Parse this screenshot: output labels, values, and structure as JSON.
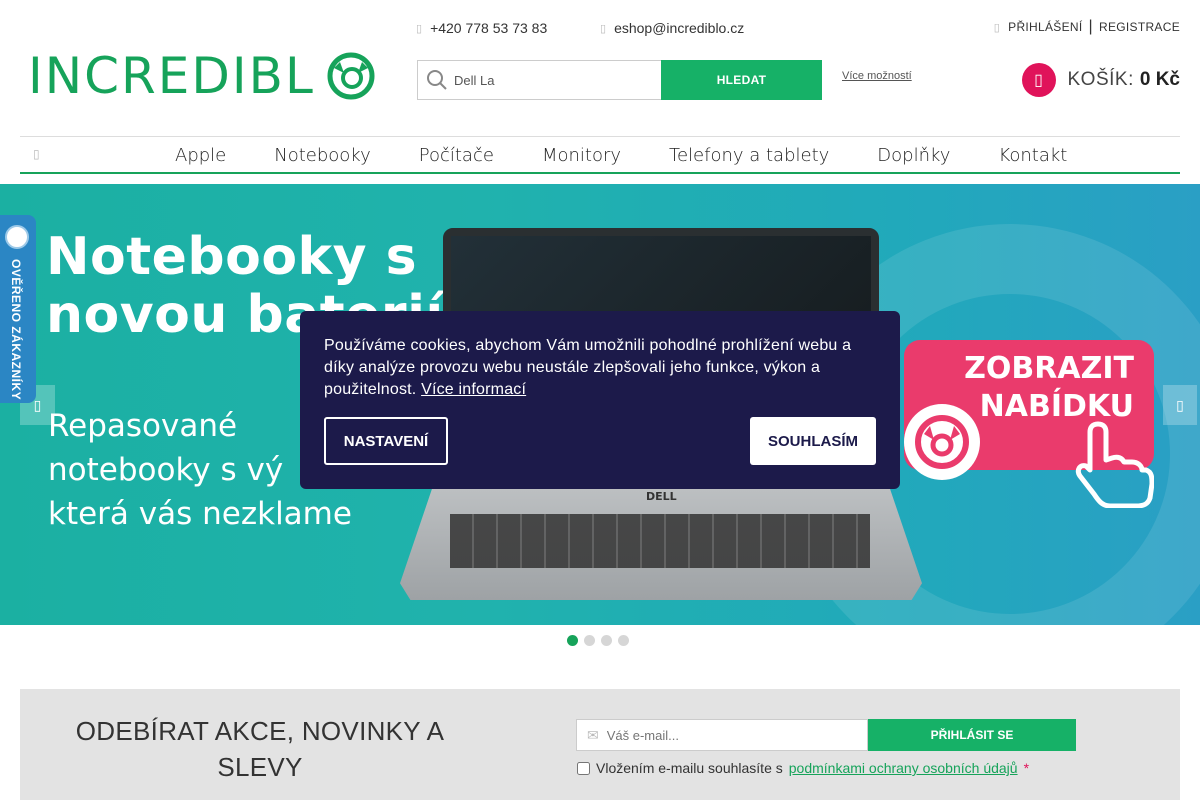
{
  "header": {
    "logo_text": "INCREDIBL",
    "phone": "+420 778 53 73 83",
    "email": "eshop@incrediblo.cz",
    "login": "PŘIHLÁŠENÍ",
    "separator": "|",
    "register": "REGISTRACE",
    "search_value": "Dell La",
    "search_button": "HLEDAT",
    "more_options": "Více možností",
    "cart_label": "KOŠÍK:",
    "cart_price": "0 Kč"
  },
  "nav": {
    "items": [
      "Apple",
      "Notebooky",
      "Počítače",
      "Monitory",
      "Telefony a tablety",
      "Doplňky",
      "Kontakt"
    ]
  },
  "hero": {
    "title_line1": "Notebooky s",
    "title_line2": "novou baterií",
    "sub_line1": "Repasované",
    "sub_line2": "notebooky s vý",
    "sub_line3": "která vás nezklame",
    "laptop_brand": "DELL",
    "cta_line1": "ZOBRAZIT",
    "cta_line2": "NABÍDKU",
    "slides_total": 4,
    "active_slide": 1
  },
  "verified_badge": {
    "text": "OVĚŘENO ZÁKAZNÍKY"
  },
  "cookie": {
    "text": "Používáme cookies, abychom Vám umožnili pohodlné prohlížení webu a díky analýze provozu webu neustále zlepšovali jeho funkce, výkon a použitelnost.",
    "link": "Více informací",
    "settings_button": "NASTAVENÍ",
    "agree_button": "SOUHLASÍM"
  },
  "newsletter": {
    "title": "ODEBÍRAT AKCE, NOVINKY A SLEVY",
    "email_placeholder": "Váš e-mail...",
    "subscribe_button": "PŘIHLÁSIT SE",
    "consent_text": "Vložením e-mailu souhlasíte s",
    "consent_link": "podmínkami ochrany osobních údajů",
    "required_mark": "*"
  },
  "colors": {
    "brand_green": "#16a35a",
    "button_green": "#16b167",
    "cart_pink": "#e0135a",
    "cookie_bg": "#1c1a4a",
    "badge_blue": "#2b86c4"
  }
}
